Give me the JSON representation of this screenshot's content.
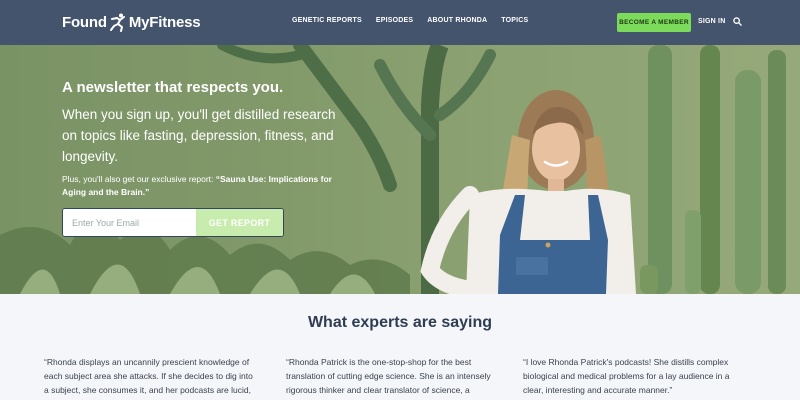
{
  "nav": {
    "logo_left": "Found",
    "logo_right": "MyFitness",
    "links": [
      "GENETIC REPORTS",
      "EPISODES",
      "ABOUT RHONDA",
      "TOPICS"
    ],
    "member_button": "BECOME A MEMBER",
    "signin": "SIGN IN"
  },
  "hero": {
    "headline": "A newsletter that respects you.",
    "lead": "When you sign up, you'll get distilled research on topics like fasting, depression, fitness, and longevity.",
    "small_prefix": "Plus, you'll also get our exclusive report: ",
    "small_bold": "“Sauna Use: Implications for Aging and the Brain.”",
    "email_placeholder": "Enter Your Email",
    "email_value": "",
    "submit_label": "GET REPORT"
  },
  "experts": {
    "title": "What experts are saying",
    "quotes": [
      "“Rhonda displays an uncannily prescient knowledge of each subject area she attacks. If she decides to dig into a subject, she consumes it, and her podcasts are lucid,",
      "“Rhonda Patrick is the one-stop-shop for the best translation of cutting edge science. She is an intensely rigorous thinker and clear translator of science, a",
      "“I love Rhonda Patrick's podcasts! She distills complex biological and medical problems for a lay audience in a clear, interesting and accurate manner.”"
    ]
  },
  "icons": {
    "logo": "runner-icon",
    "search": "search-icon"
  },
  "colors": {
    "nav_bg": "#44546d",
    "accent_green": "#7ddb5c",
    "submit_green": "#c8ecae"
  }
}
